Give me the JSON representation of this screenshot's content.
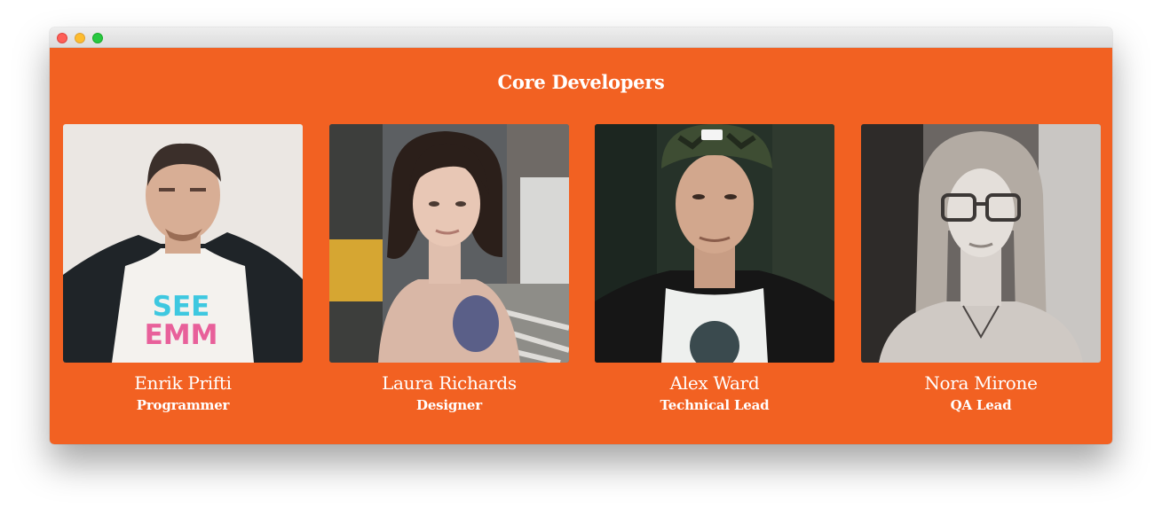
{
  "colors": {
    "accent": "#f26122",
    "traffic_close": "#fe5f57",
    "traffic_minimize": "#febc2e",
    "traffic_maximize": "#28c840"
  },
  "window": {
    "controls": [
      "close-icon",
      "minimize-icon",
      "maximize-icon"
    ]
  },
  "section": {
    "title": "Core Developers"
  },
  "team": [
    {
      "name": "Enrik Prifti",
      "role": "Programmer",
      "shirt_text": [
        "SEE",
        "EMM"
      ]
    },
    {
      "name": "Laura Richards",
      "role": "Designer"
    },
    {
      "name": "Alex Ward",
      "role": "Technical Lead"
    },
    {
      "name": "Nora Mirone",
      "role": "QA Lead"
    }
  ]
}
